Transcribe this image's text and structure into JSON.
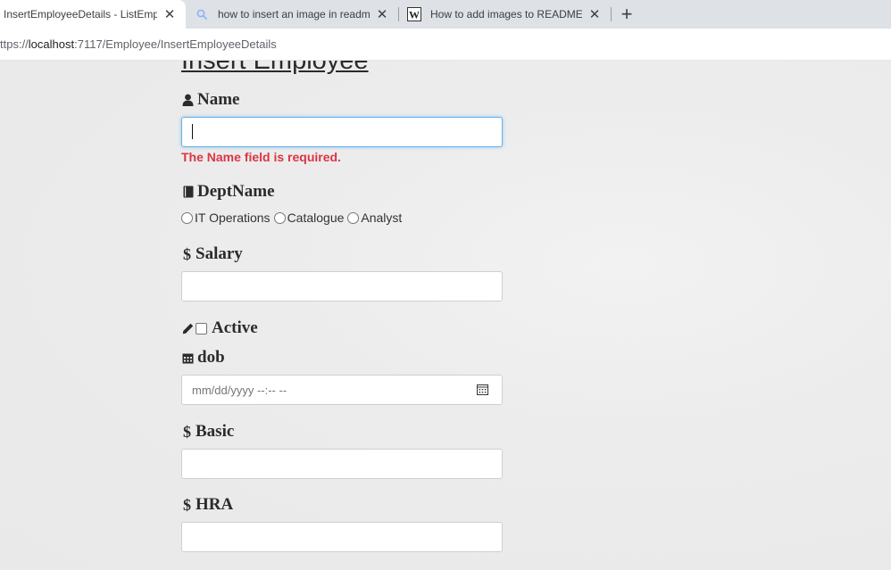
{
  "browser": {
    "tabs": [
      {
        "title": "InsertEmployeeDetails - ListEmpl",
        "icon": "none",
        "active": true
      },
      {
        "title": "how to insert an image in readm",
        "icon": "search-icon",
        "active": false
      },
      {
        "title": "How to add images to README.m",
        "icon": "wiki-w-icon",
        "active": false
      }
    ],
    "new_tab_glyph": "+",
    "close_glyph": "✕",
    "url": {
      "prefix": "ttps://",
      "host": "localhost",
      "rest": ":7117/Employee/InsertEmployeeDetails"
    }
  },
  "form": {
    "heading": "Insert Employee",
    "name": {
      "label": "Name",
      "value": "",
      "error": "The Name field is required."
    },
    "dept": {
      "label": "DeptName",
      "options": [
        "IT Operations",
        "Catalogue",
        "Analyst"
      ]
    },
    "salary": {
      "label": "Salary",
      "symbol": "$",
      "value": ""
    },
    "active": {
      "label": "Active",
      "checked": false
    },
    "dob": {
      "label": "dob",
      "placeholder": "mm/dd/yyyy --:-- --"
    },
    "basic": {
      "label": "Basic",
      "symbol": "$",
      "value": ""
    },
    "hra": {
      "label": "HRA",
      "symbol": "$",
      "value": ""
    }
  },
  "colors": {
    "error": "#dc3545",
    "focus_border": "#66afe9",
    "tabstrip": "#dee1e6"
  }
}
